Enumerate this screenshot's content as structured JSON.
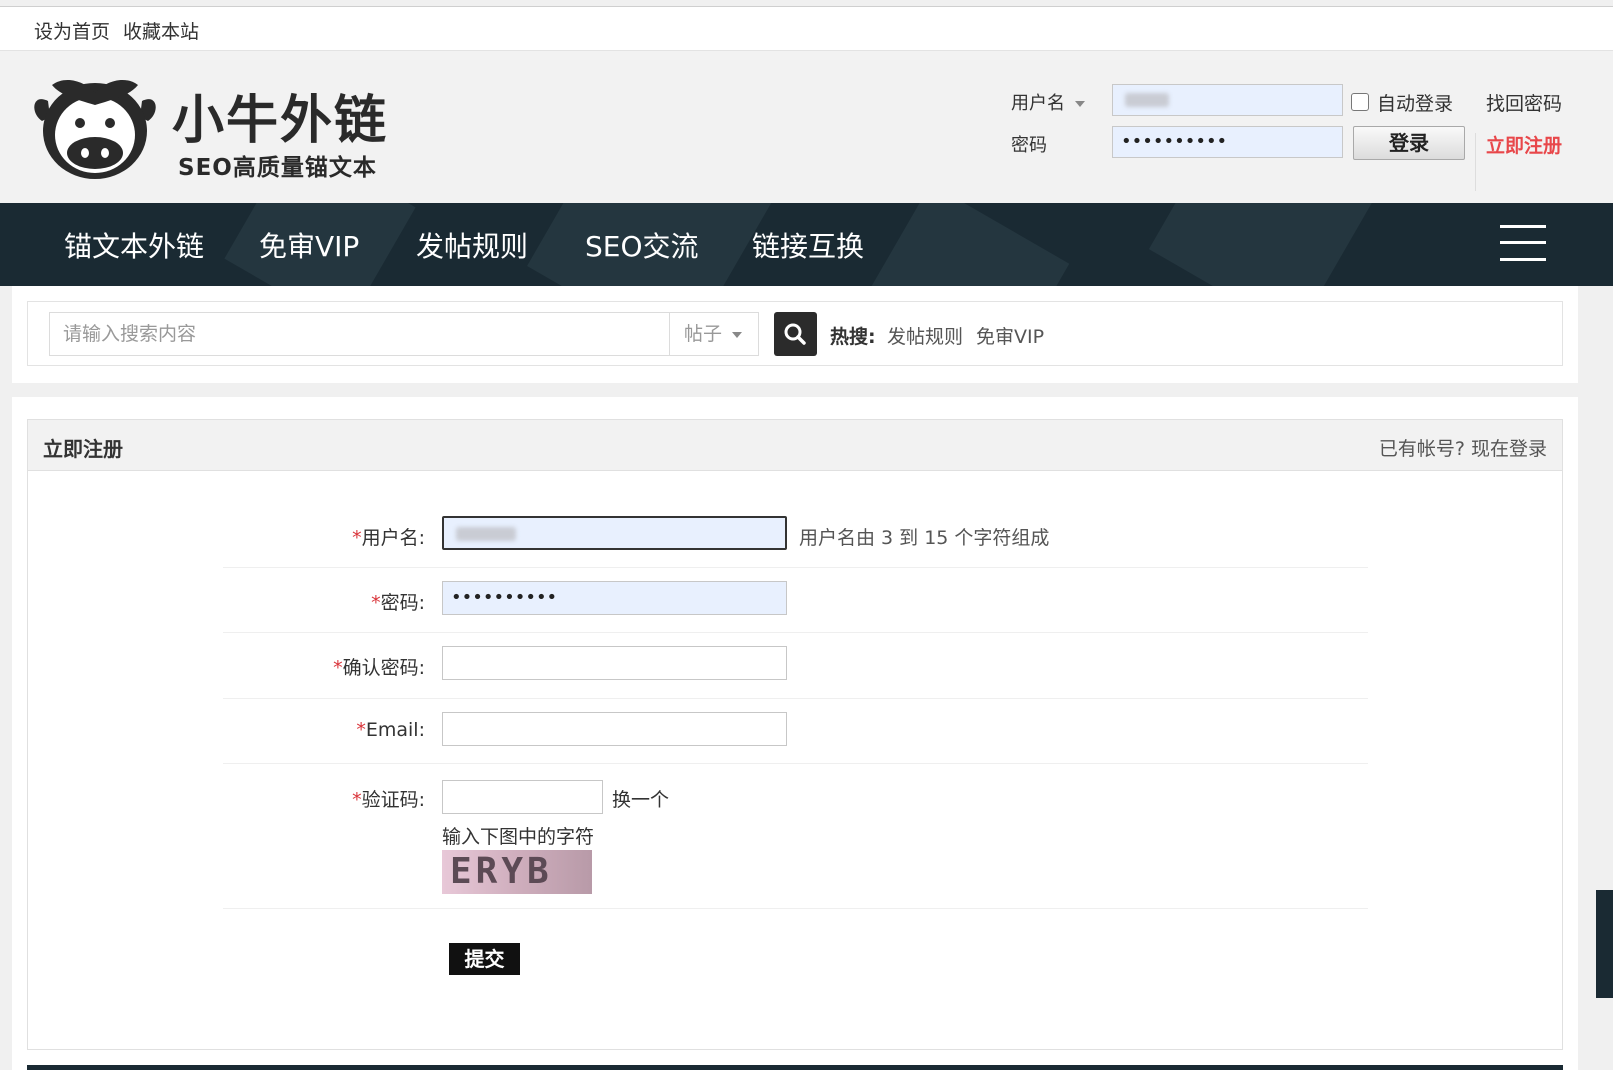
{
  "topbar": {
    "set_home": "设为首页",
    "bookmark": "收藏本站"
  },
  "header": {
    "logo_title": "小牛外链",
    "logo_subtitle": "SEO高质量锚文本"
  },
  "login": {
    "username_label": "用户名",
    "password_label": "密码",
    "password_value": "••••••••••",
    "auto_login": "自动登录",
    "login_button": "登录",
    "forgot_password": "找回密码",
    "register": "立即注册"
  },
  "nav": {
    "items": [
      "锚文本外链",
      "免审VIP",
      "发帖规则",
      "SEO交流",
      "链接互换"
    ]
  },
  "search": {
    "placeholder": "请输入搜索内容",
    "type": "帖子",
    "hot_label": "热搜:",
    "hot_links": [
      "发帖规则",
      "免审VIP"
    ]
  },
  "register": {
    "title": "立即注册",
    "have_account": "已有帐号? 现在登录",
    "required_mark": "*",
    "username_label": "用户名:",
    "username_hint": "用户名由 3 到 15 个字符组成",
    "password_label": "密码:",
    "password_value": "••••••••••",
    "confirm_label": "确认密码:",
    "email_label": "Email:",
    "captcha_label": "验证码:",
    "captcha_refresh": "换一个",
    "captcha_hint": "输入下图中的字符",
    "captcha_text": "ERYB",
    "submit": "提交"
  }
}
